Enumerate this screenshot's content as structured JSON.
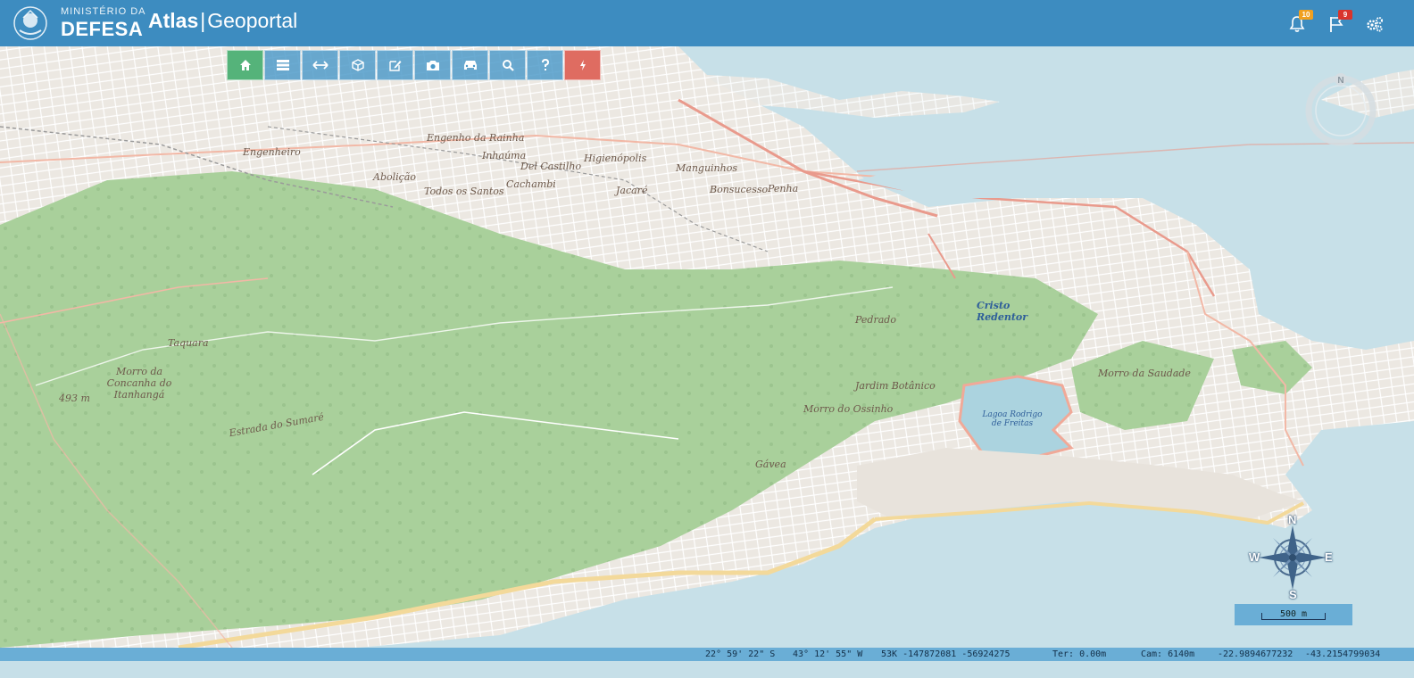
{
  "header": {
    "ministry_small": "MINISTÉRIO DA",
    "ministry_big": "DEFESA",
    "app_name_bold": "Atlas",
    "app_name_separator": "|",
    "app_name_rest": "Geoportal",
    "icons": [
      {
        "name": "bell-icon",
        "badge": "10",
        "badge_color": "#f0a020"
      },
      {
        "name": "flag-icon",
        "badge": "9",
        "badge_color": "#d9342b"
      },
      {
        "name": "gears-icon",
        "badge": null
      }
    ]
  },
  "toolbar": {
    "buttons": [
      {
        "name": "home-button",
        "icon": "home-icon",
        "color": "#55b37a"
      },
      {
        "name": "layers-button",
        "icon": "layers-icon"
      },
      {
        "name": "measure-button",
        "icon": "arrows-h-icon"
      },
      {
        "name": "3d-button",
        "icon": "cube-icon"
      },
      {
        "name": "draw-button",
        "icon": "edit-icon"
      },
      {
        "name": "screenshot-button",
        "icon": "camera-icon"
      },
      {
        "name": "vehicle-button",
        "icon": "car-icon"
      },
      {
        "name": "search-button",
        "icon": "search-icon"
      },
      {
        "name": "help-button",
        "icon": "question-icon"
      },
      {
        "name": "power-button",
        "icon": "bolt-icon",
        "color": "#df6c61"
      }
    ]
  },
  "map": {
    "labels": [
      "Engenheiro",
      "Abolição",
      "Todos os Santos",
      "Engenho da Rainha",
      "Inhaúma",
      "Del Castilho",
      "Cachambi",
      "Higienópolis",
      "Manguinhos",
      "Jacaré",
      "Bonsucesso",
      "Penha",
      "Taquara",
      "Morro da Concanha do Itanhangá",
      "493 m",
      "Estrada do Sumaré",
      "Jardim Botânico",
      "Gávea",
      "Cristo Redentor",
      "Lagoa Rodrigo de Freitas",
      "Pedrado",
      "Morro do Ossinho",
      "Morro da Saudade"
    ],
    "compass_letters": {
      "n": "N",
      "s": "S",
      "e": "E",
      "w": "W"
    },
    "ring_letter": "N",
    "scale_label": "500 m"
  },
  "status": {
    "lat": "22° 59' 22\" S",
    "lon": "43° 12' 55\" W",
    "grid": "53K -147872081 -56924275",
    "terrain": "Ter: 0.00m",
    "camera": "Cam: 6140m",
    "dec_lat": "-22.9894677232",
    "dec_lon": "-43.2154799034"
  }
}
